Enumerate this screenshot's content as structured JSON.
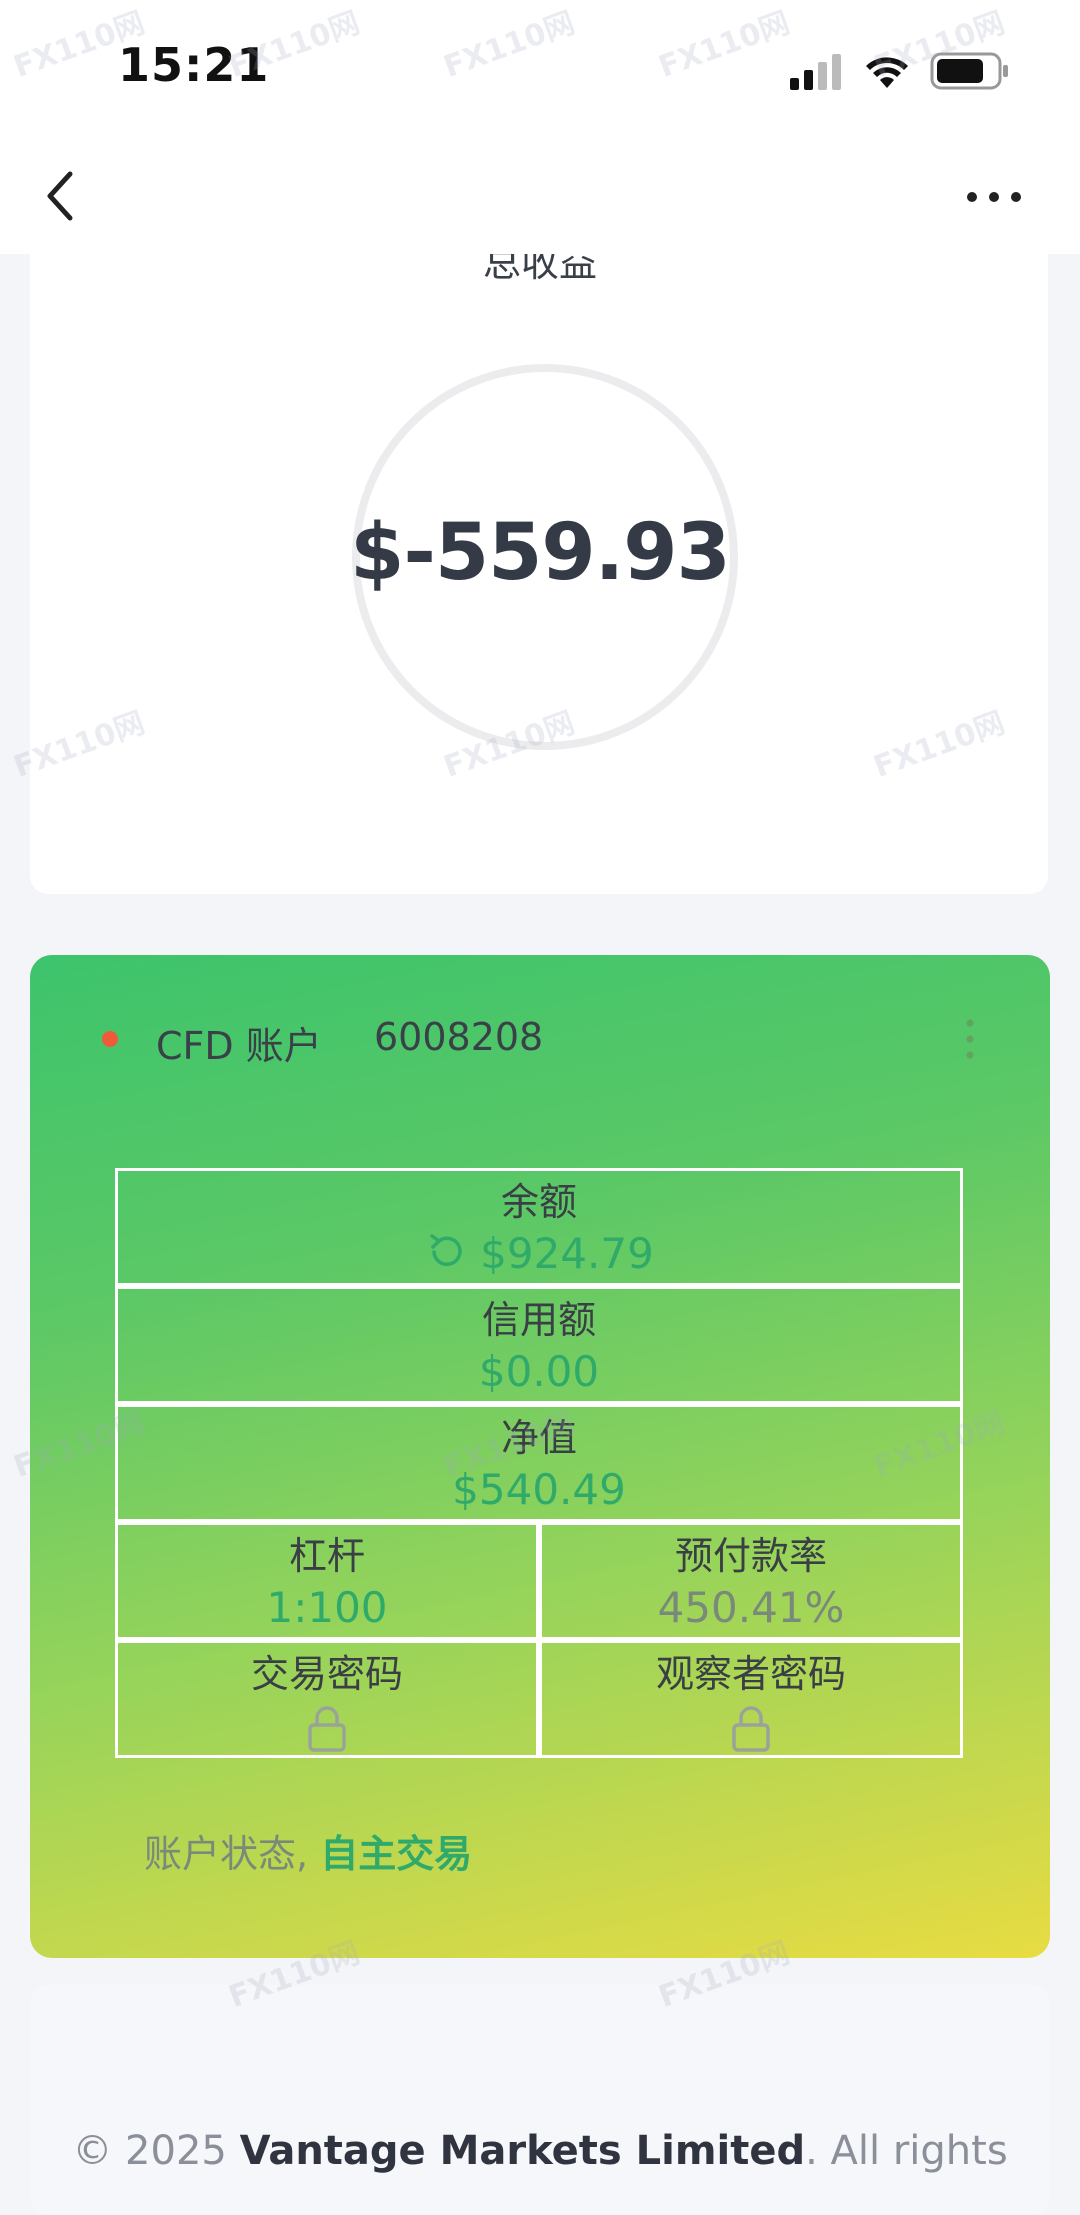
{
  "status_bar": {
    "time": "15:21"
  },
  "summary": {
    "title": "总收益",
    "total_value": "$-559.93"
  },
  "account": {
    "type": "CFD 账户",
    "number": "6008208",
    "balance_label": "余额",
    "balance_value": "$924.79",
    "credit_label": "信用额",
    "credit_value": "$0.00",
    "equity_label": "净值",
    "equity_value": "$540.49",
    "leverage_label": "杠杆",
    "leverage_value": "1:100",
    "margin_label": "预付款率",
    "margin_value": "450.41%",
    "trade_pwd_label": "交易密码",
    "viewer_pwd_label": "观察者密码",
    "status_label": "账户状态,",
    "status_value": "自主交易"
  },
  "footer": {
    "prefix": "© 2025",
    "company": "Vantage Markets Limited",
    "suffix": ". All rights"
  },
  "watermark": "FX110网",
  "colors": {
    "accent_green": "#2faa6b",
    "status_dot": "#ef5a3a"
  }
}
